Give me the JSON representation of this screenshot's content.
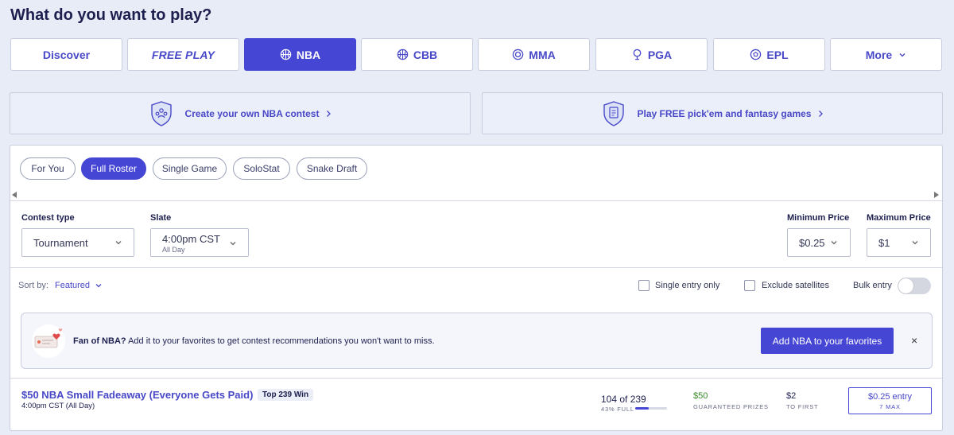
{
  "heading": "What do you want to play?",
  "sport_tabs": [
    {
      "label": "Discover",
      "icon": null,
      "active": false
    },
    {
      "label": "FREE PLAY",
      "icon": null,
      "active": false
    },
    {
      "label": "NBA",
      "icon": "basketball-icon",
      "active": true
    },
    {
      "label": "CBB",
      "icon": "basketball-icon",
      "active": false
    },
    {
      "label": "MMA",
      "icon": "target-icon",
      "active": false
    },
    {
      "label": "PGA",
      "icon": "golf-pin-icon",
      "active": false
    },
    {
      "label": "EPL",
      "icon": "soccer-ball-icon",
      "active": false
    },
    {
      "label": "More",
      "icon": "chevron-down-icon",
      "active": false
    }
  ],
  "promos": [
    {
      "label": "Create your own NBA contest",
      "icon": "shield-people-icon"
    },
    {
      "label": "Play FREE pick'em and fantasy games",
      "icon": "shield-clipboard-icon"
    }
  ],
  "type_chips": [
    {
      "label": "For You",
      "active": false
    },
    {
      "label": "Full Roster",
      "active": true
    },
    {
      "label": "Single Game",
      "active": false
    },
    {
      "label": "SoloStat",
      "active": false
    },
    {
      "label": "Snake Draft",
      "active": false
    }
  ],
  "filters": {
    "contest_type": {
      "label": "Contest type",
      "value": "Tournament"
    },
    "slate": {
      "label": "Slate",
      "value": "4:00pm CST",
      "sub": "All Day"
    },
    "min_price": {
      "label": "Minimum Price",
      "value": "$0.25"
    },
    "max_price": {
      "label": "Maximum Price",
      "value": "$1"
    }
  },
  "sort": {
    "label": "Sort by:",
    "value": "Featured"
  },
  "toggles": {
    "single_entry": "Single entry only",
    "exclude_satellites": "Exclude satellites",
    "bulk_entry": "Bulk entry"
  },
  "favorite_banner": {
    "bold": "Fan of NBA?",
    "text": "Add it to your favorites to get contest recommendations you won't want to miss.",
    "button": "Add NBA to your favorites",
    "close": "×"
  },
  "contest": {
    "title": "$50 NBA Small Fadeaway (Everyone Gets Paid)",
    "badge": "Top 239 Win",
    "time": "4:00pm CST (All Day)",
    "entries": "104 of 239",
    "fill_pct": 43,
    "fill_label": "43% FULL",
    "prize": "$50",
    "prize_label": "GUARANTEED PRIZES",
    "first": "$2",
    "first_label": "TO FIRST",
    "entry_fee": "$0.25 entry",
    "max": "7 MAX"
  },
  "colors": {
    "accent": "#4646d4",
    "prize_green": "#3a8a2a"
  }
}
